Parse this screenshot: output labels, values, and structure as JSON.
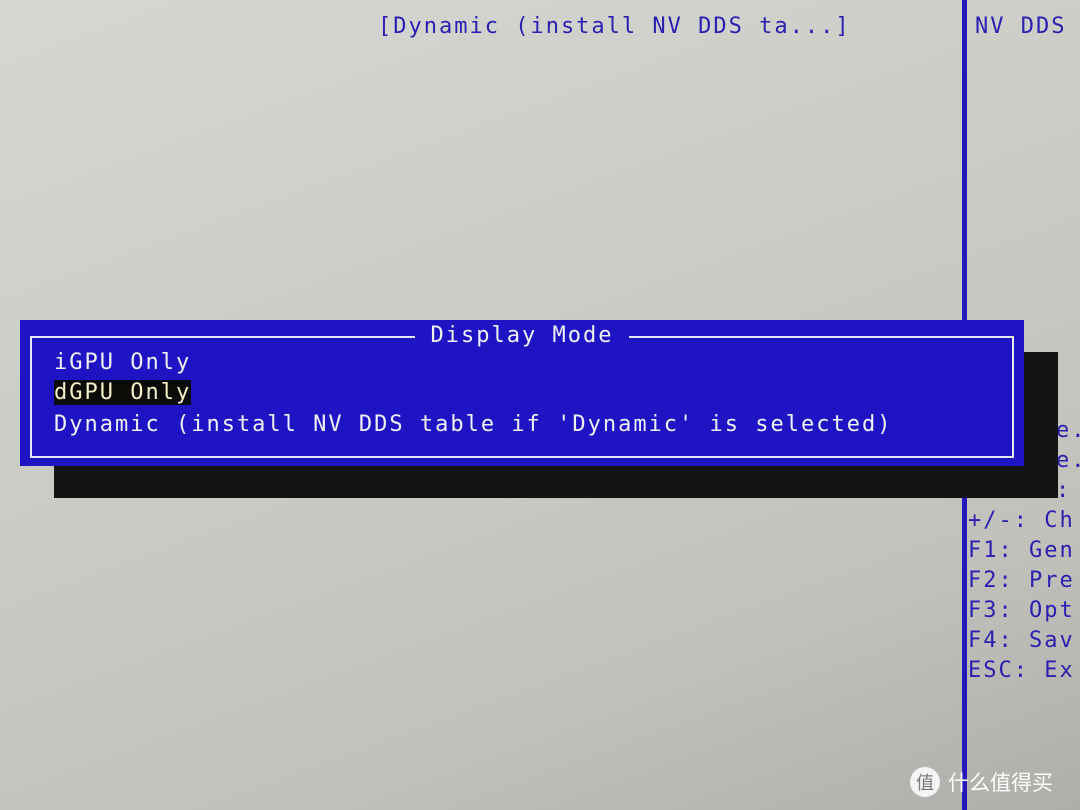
{
  "setting_value": "[Dynamic (install NV DDS ta...]",
  "help_panel": {
    "heading": "NV DDS",
    "fragments": [
      "e.",
      "e.",
      ":"
    ],
    "keys": [
      "+/-: Ch",
      "F1: Gen",
      "F2: Pre",
      "F3: Opt",
      "F4: Sav",
      "ESC: Ex"
    ]
  },
  "dialog": {
    "title": "Display Mode",
    "options": [
      "iGPU Only",
      "dGPU Only",
      "Dynamic (install NV DDS table if 'Dynamic' is selected)"
    ],
    "selected": "dGPU Only"
  },
  "watermark": {
    "logo": "值",
    "text": "什么值得买"
  },
  "colors": {
    "dialog_bg": "#1f14c4",
    "text_blue": "#2a1fb0",
    "highlight": "#0b0b08"
  }
}
